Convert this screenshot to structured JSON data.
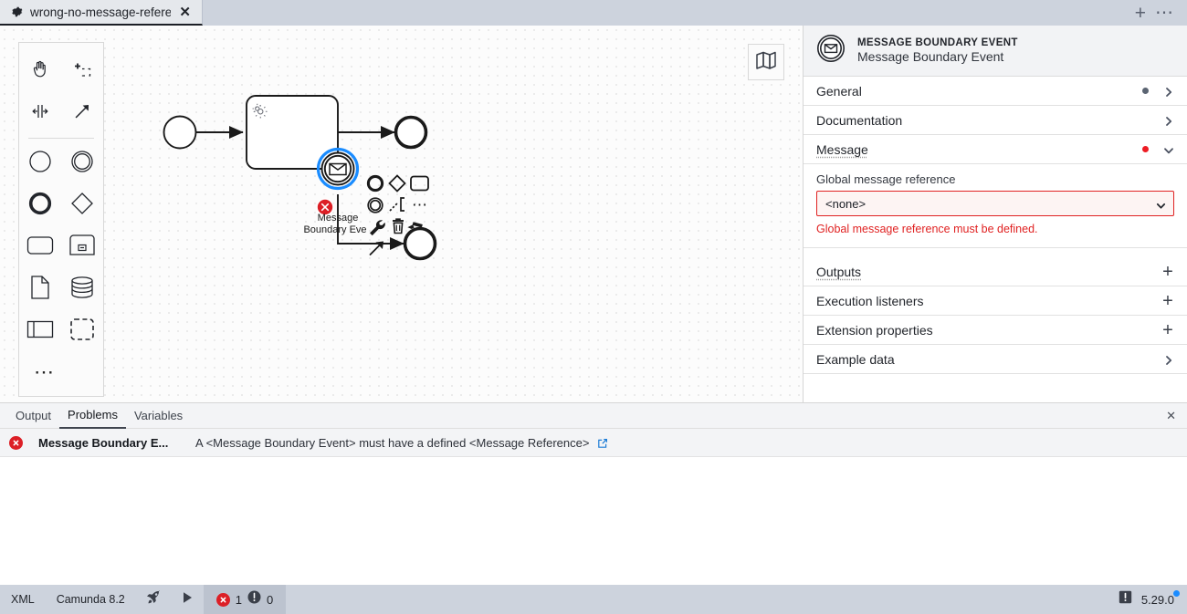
{
  "tab": {
    "title": "wrong-no-message-refere",
    "gear_icon": "gear-icon",
    "close_icon": "close-icon",
    "new_tab_icon": "plus-icon",
    "more_icon": "ellipsis-icon"
  },
  "palette": {
    "tools": [
      {
        "name": "hand-tool",
        "icon": "hand-icon"
      },
      {
        "name": "lasso-tool",
        "icon": "lasso-select-icon"
      },
      {
        "name": "space-tool",
        "icon": "space-tool-icon"
      },
      {
        "name": "global-connect-tool",
        "icon": "arrow-connect-icon"
      }
    ],
    "elements": [
      {
        "name": "create-start-event",
        "icon": "circle-thin-icon"
      },
      {
        "name": "create-intermediate-event",
        "icon": "double-circle-icon"
      },
      {
        "name": "create-end-event",
        "icon": "circle-thick-icon"
      },
      {
        "name": "create-gateway",
        "icon": "diamond-icon"
      },
      {
        "name": "create-task",
        "icon": "rounded-rect-icon"
      },
      {
        "name": "create-subprocess-expanded",
        "icon": "subprocess-icon"
      },
      {
        "name": "create-data-object",
        "icon": "document-icon"
      },
      {
        "name": "create-data-store",
        "icon": "database-icon"
      },
      {
        "name": "create-participant",
        "icon": "pool-icon"
      },
      {
        "name": "create-group",
        "icon": "dashed-rect-icon"
      }
    ],
    "more_icon": "ellipsis-icon"
  },
  "canvas": {
    "minimap_icon": "map-icon",
    "boundary_event_label": "Message\nBoundary Eve",
    "boundary_event_label_line1": "Message",
    "boundary_event_label_line2": "Boundary Eve",
    "task_marker_icon": "service-task-gear-icon",
    "error_marker_icon": "error-circle-icon",
    "context_pad": [
      {
        "name": "append-end-event",
        "icon": "circle-thick-icon"
      },
      {
        "name": "append-gateway",
        "icon": "diamond-icon"
      },
      {
        "name": "append-task",
        "icon": "rounded-rect-icon"
      },
      {
        "name": "append-intermediate-event",
        "icon": "double-circle-icon"
      },
      {
        "name": "append-text-annotation",
        "icon": "text-annotation-icon"
      },
      {
        "name": "context-more-options",
        "icon": "ellipsis-icon"
      },
      {
        "name": "change-element-wrench",
        "icon": "wrench-icon"
      },
      {
        "name": "delete-element",
        "icon": "trash-icon"
      },
      {
        "name": "set-color",
        "icon": "paint-brush-icon"
      },
      {
        "name": "connect",
        "icon": "arrow-connect-icon"
      }
    ]
  },
  "properties": {
    "header": {
      "type": "MESSAGE BOUNDARY EVENT",
      "name": "Message Boundary Event",
      "icon": "message-boundary-event-icon"
    },
    "groups": [
      {
        "label": "General",
        "dot": "gray",
        "chevron": "right",
        "action": "none"
      },
      {
        "label": "Documentation",
        "dot": "none",
        "chevron": "right",
        "action": "none"
      },
      {
        "label": "Message",
        "dot": "red",
        "chevron": "down",
        "action": "none"
      }
    ],
    "message_group": {
      "field_label": "Global message reference",
      "select_value": "<none>",
      "select_options": [
        "<none>"
      ],
      "error": "Global message reference must be defined."
    },
    "groups_after": [
      {
        "label": "Outputs",
        "action": "plus"
      },
      {
        "label": "Execution listeners",
        "action": "plus"
      },
      {
        "label": "Extension properties",
        "action": "plus"
      },
      {
        "label": "Example data",
        "action": "chevron-right"
      }
    ]
  },
  "bottom_panel": {
    "tabs": [
      {
        "label": "Output",
        "active": false
      },
      {
        "label": "Problems",
        "active": true
      },
      {
        "label": "Variables",
        "active": false
      }
    ],
    "close_icon": "close-icon",
    "problems": [
      {
        "severity_icon": "error-circle-icon",
        "element": "Message Boundary E...",
        "message": "A <Message Boundary Event> must have a defined <Message Reference>",
        "link_icon": "external-link-icon"
      }
    ]
  },
  "status_bar": {
    "format": "XML",
    "engine": "Camunda 8.2",
    "deploy_icon": "rocket-icon",
    "run_icon": "play-icon",
    "error_icon": "error-circle-icon",
    "error_count": "1",
    "warning_icon": "warning-circle-icon",
    "warning_count": "0",
    "notifications_icon": "notification-icon",
    "version": "5.29.0",
    "update_dot_color": "#1a8cff"
  },
  "colors": {
    "error_red": "#e02222",
    "accent_blue": "#1a8cff",
    "chrome": "#cdd3dd"
  }
}
